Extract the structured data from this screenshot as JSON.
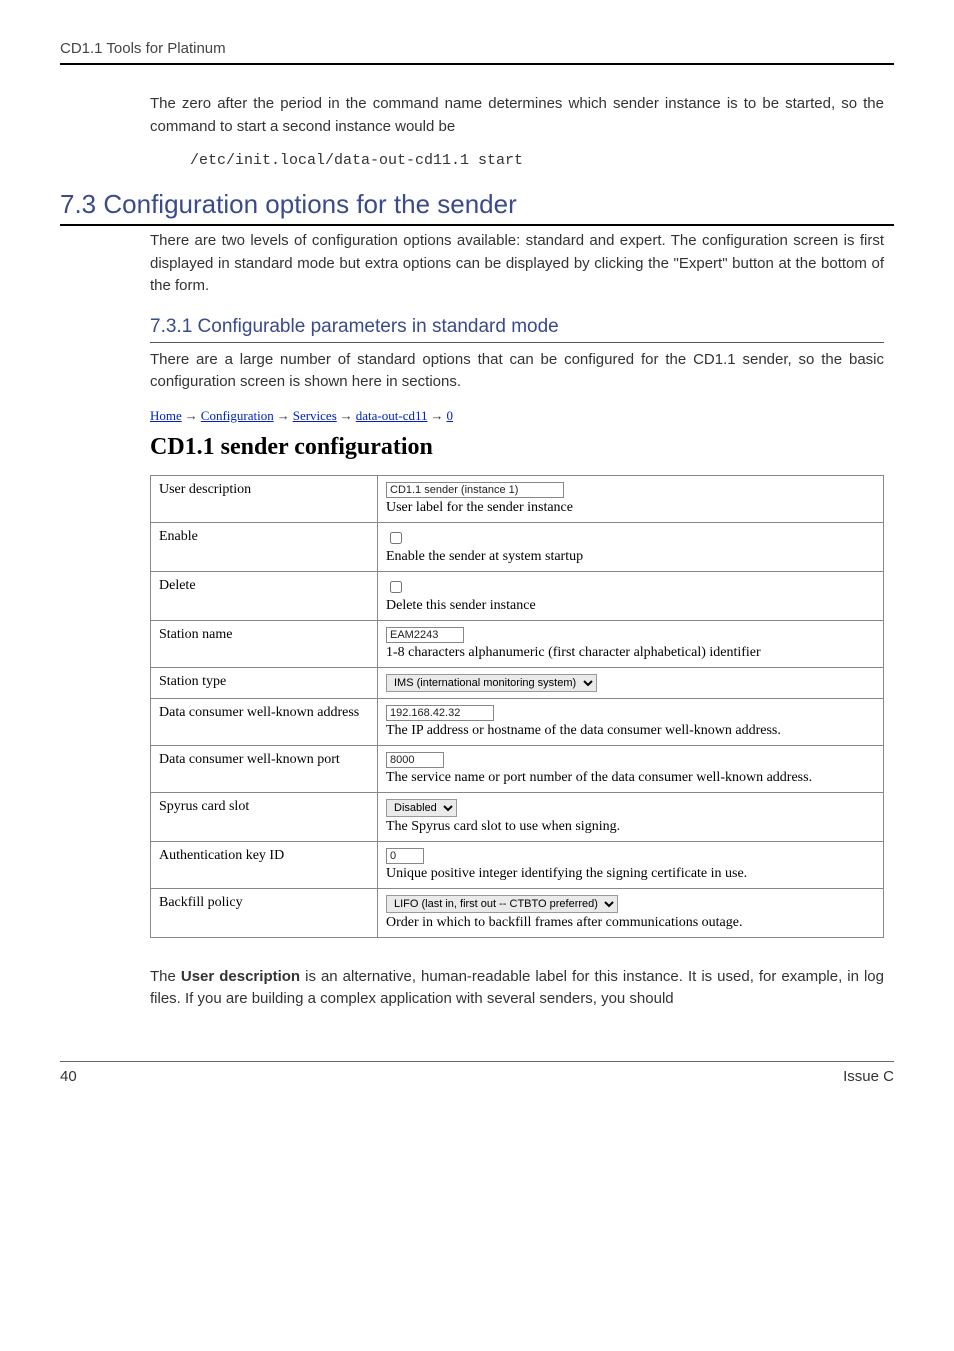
{
  "header": {
    "running_title": "CD1.1 Tools for Platinum"
  },
  "intro": {
    "para1": "The zero after the period in the command name determines which  sender instance is to be started, so the command to start a second instance would be",
    "code": "/etc/init.local/data-out-cd11.1 start"
  },
  "section": {
    "number": "7.3",
    "title": "Configuration options for the sender",
    "para": "There are two levels of configuration options available: standard and expert.  The configuration screen is first displayed in standard mode but extra options can be displayed by clicking the \"Expert\" button at the bottom of the form."
  },
  "subsection": {
    "number": "7.3.1",
    "title": "Configurable parameters in standard mode",
    "para": "There are a large number of standard options that can be configured for the CD1.1 sender, so the basic configuration screen is shown here in sections."
  },
  "breadcrumbs": [
    "Home",
    "Configuration",
    "Services",
    "data-out-cd11",
    "0"
  ],
  "panel": {
    "title": "CD1.1 sender configuration",
    "rows": {
      "user_description": {
        "label": "User description",
        "value": "CD1.1 sender (instance 1)",
        "help": "User label for the sender instance"
      },
      "enable": {
        "label": "Enable",
        "help": "Enable the sender at system startup"
      },
      "delete": {
        "label": "Delete",
        "help": "Delete this sender instance"
      },
      "station_name": {
        "label": "Station name",
        "value": "EAM2243",
        "help": "1-8 characters alphanumeric (first character alphabetical) identifier"
      },
      "station_type": {
        "label": "Station type",
        "value": "IMS (international monitoring system)"
      },
      "consumer_addr": {
        "label": "Data consumer well-known address",
        "value": "192.168.42.32",
        "help": "The IP address or hostname of the data consumer well-known address."
      },
      "consumer_port": {
        "label": "Data consumer well-known port",
        "value": "8000",
        "help": "The service name or port number of the data consumer well-known address."
      },
      "spyrus": {
        "label": "Spyrus card slot",
        "value": "Disabled",
        "help": "The Spyrus card slot to use when signing."
      },
      "auth_key": {
        "label": "Authentication key ID",
        "value": "0",
        "help": "Unique positive integer identifying the signing certificate in use."
      },
      "backfill": {
        "label": "Backfill policy",
        "value": "LIFO (last in, first out -- CTBTO preferred)",
        "help": "Order in which to backfill frames after communications outage."
      }
    }
  },
  "closing": {
    "prefix": "The ",
    "bold": "User description",
    "rest": " is an alternative, human-readable label for this instance.  It is used, for example, in log files.  If you are building a complex application with several senders, you should"
  },
  "footer": {
    "page": "40",
    "issue": "Issue C"
  }
}
